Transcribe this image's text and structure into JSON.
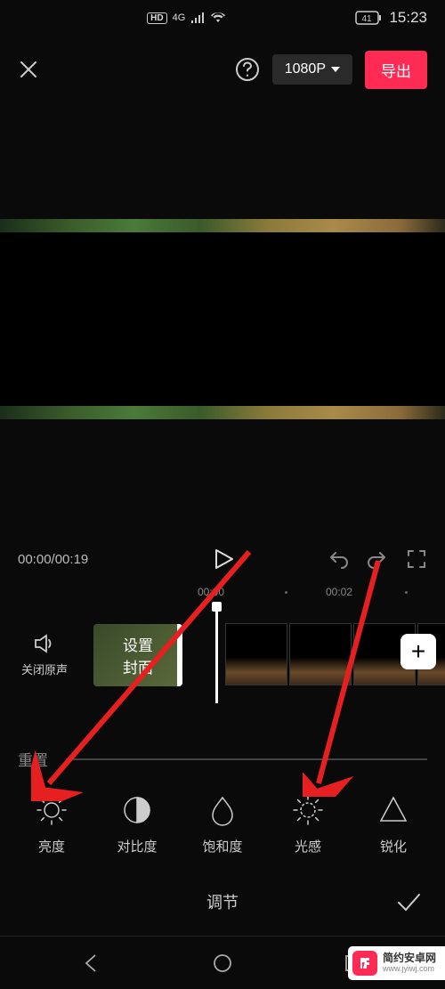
{
  "status_bar": {
    "hd": "HD",
    "network": "4G",
    "battery": "41",
    "time": "15:23"
  },
  "top_bar": {
    "resolution": "1080P",
    "export": "导出"
  },
  "playback": {
    "current": "00:00",
    "total": "00:19"
  },
  "timeline": {
    "marks": [
      "00:00",
      "00:02"
    ],
    "audio_label": "关闭原声",
    "cover_label": "设置\n封面"
  },
  "adjust": {
    "reset": "重置",
    "tools": [
      {
        "id": "brightness",
        "label": "亮度"
      },
      {
        "id": "contrast",
        "label": "对比度"
      },
      {
        "id": "saturation",
        "label": "饱和度"
      },
      {
        "id": "light-sense",
        "label": "光感"
      },
      {
        "id": "sharpen",
        "label": "锐化"
      }
    ],
    "title": "调节"
  },
  "watermark": {
    "cn": "简约安卓网",
    "url": "www.jyiwj.com"
  }
}
